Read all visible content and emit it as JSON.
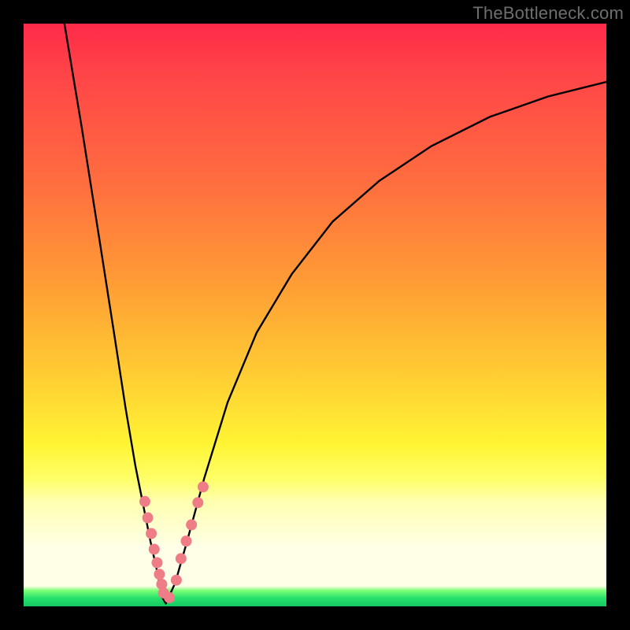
{
  "watermark": "TheBottleneck.com",
  "chart_data": {
    "type": "line",
    "title": "",
    "xlabel": "",
    "ylabel": "",
    "xlim": [
      0,
      100
    ],
    "ylim": [
      0,
      100
    ],
    "grid": false,
    "curve_left": {
      "name": "left-branch",
      "x": [
        7.0,
        10.0,
        13.0,
        15.5,
        17.5,
        19.2,
        20.6,
        21.8,
        22.8,
        23.4,
        23.8,
        24.4
      ],
      "values": [
        100.0,
        82.0,
        63.0,
        47.0,
        34.0,
        24.0,
        17.0,
        11.0,
        6.5,
        3.5,
        1.5,
        0.5
      ]
    },
    "curve_right": {
      "name": "right-branch",
      "x": [
        24.4,
        26.0,
        28.0,
        31.0,
        35.0,
        40.0,
        46.0,
        53.0,
        61.0,
        70.0,
        80.0,
        90.0,
        100.0
      ],
      "values": [
        0.5,
        4.0,
        11.0,
        22.0,
        35.0,
        47.0,
        57.0,
        66.0,
        73.0,
        79.0,
        84.0,
        87.5,
        90.0
      ]
    },
    "markers_left": {
      "name": "left-markers",
      "x": [
        20.8,
        21.3,
        21.9,
        22.4,
        22.9,
        23.3,
        23.7,
        24.0
      ],
      "values": [
        18.0,
        15.2,
        12.5,
        9.8,
        7.5,
        5.5,
        3.8,
        2.3
      ]
    },
    "markers_right": {
      "name": "right-markers",
      "x": [
        25.0,
        26.2,
        27.0,
        27.9,
        28.8,
        29.9,
        30.8
      ],
      "values": [
        1.5,
        4.5,
        8.2,
        11.2,
        14.0,
        17.8,
        20.5
      ]
    },
    "marker_color": "#ee7d87",
    "curve_color": "#000000",
    "gradient_stops": [
      {
        "pos": 0.0,
        "color": "#ff2a49"
      },
      {
        "pos": 0.28,
        "color": "#ff6f3f"
      },
      {
        "pos": 0.62,
        "color": "#ffd233"
      },
      {
        "pos": 0.82,
        "color": "#ffffb0"
      },
      {
        "pos": 0.97,
        "color": "#7aff76"
      },
      {
        "pos": 1.0,
        "color": "#14c85f"
      }
    ]
  }
}
